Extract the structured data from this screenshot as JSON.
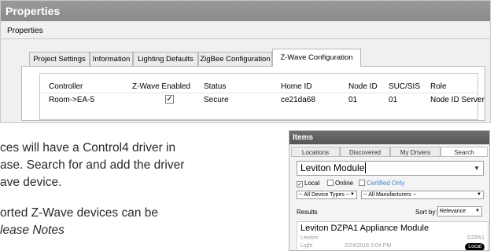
{
  "properties": {
    "title": "Properties",
    "subtitle": "Properties",
    "tabs": [
      {
        "label": "Project Settings"
      },
      {
        "label": "Information"
      },
      {
        "label": "Lighting Defaults"
      },
      {
        "label": "ZigBee Configuration"
      },
      {
        "label": "Z-Wave Configuration",
        "active": true
      }
    ],
    "zwave": {
      "columns": [
        "Controller",
        "Z-Wave Enabled",
        "Status",
        "Home ID",
        "Node ID",
        "SUC/SIS",
        "Role"
      ],
      "row": {
        "controller": "Room->EA-5",
        "enabled_mark": "✓",
        "status": "Secure",
        "home_id": "ce21da68",
        "node_id": "01",
        "suc_sis": "01",
        "role": "Node ID Server"
      }
    }
  },
  "body_text": {
    "line1": "ces will have a Control4 driver in",
    "line2": "ase. Search for and add the driver",
    "line3": "ave device.",
    "line4": "orted Z-Wave devices can be",
    "line5": "lease Notes"
  },
  "items_panel": {
    "title": "Items",
    "tabs": [
      {
        "label": "Locations"
      },
      {
        "label": "Discovered"
      },
      {
        "label": "My Drivers"
      },
      {
        "label": "Search",
        "active": true
      }
    ],
    "search_value": "Leviton Module",
    "filters": [
      {
        "label": "Local",
        "checked": true
      },
      {
        "label": "Online",
        "checked": false
      },
      {
        "label": "Certified Only",
        "checked": false,
        "color": "#3a7fd0"
      }
    ],
    "device_type_select": "-- All Device Types --",
    "manufacturer_select": "-- All Manufacturers --",
    "results_label": "Results",
    "sort_label": "Sort by:",
    "sort_value": "Relevance",
    "result": {
      "name": "Leviton DZPA1 Appliance Module",
      "brand": "Leviton",
      "model": "DZPA1",
      "type": "Light",
      "date": "2/24/2016 2:04 PM",
      "badge": "Local"
    }
  }
}
